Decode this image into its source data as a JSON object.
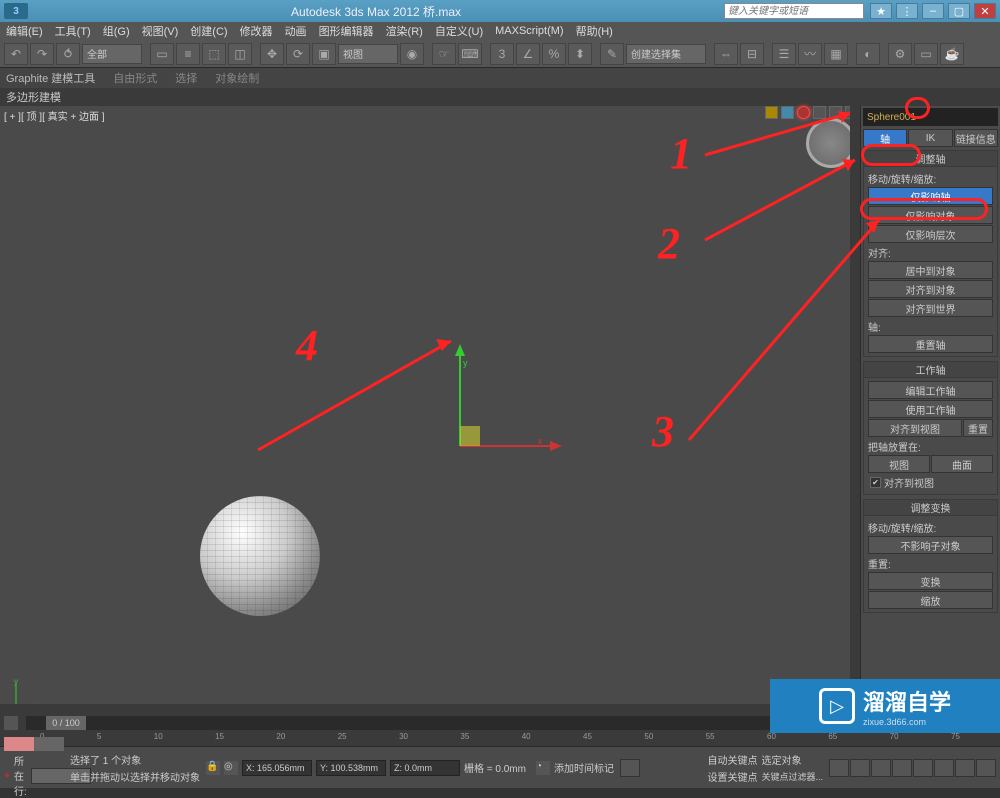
{
  "titlebar": {
    "logo": "3",
    "title": "Autodesk 3ds Max 2012      桥.max",
    "search_placeholder": "键入关键字或短语"
  },
  "menu": [
    "编辑(E)",
    "工具(T)",
    "组(G)",
    "视图(V)",
    "创建(C)",
    "修改器",
    "动画",
    "图形编辑器",
    "渲染(R)",
    "自定义(U)",
    "MAXScript(M)",
    "帮助(H)"
  ],
  "toolbar1": {
    "select_set": "全部",
    "view": "视图",
    "selfilter": "创建选择集"
  },
  "ribbon": {
    "title": "Graphite 建模工具",
    "tabs": [
      "自由形式",
      "选择",
      "对象绘制"
    ],
    "sub": "多边形建模"
  },
  "viewport": {
    "label": "[ + ][ 顶 ][ 真实 + 边面 ]",
    "axis_x": "x",
    "axis_y": "y"
  },
  "object_name": "Sphere001",
  "hier_tabs": {
    "pivot": "轴",
    "ik": "IK",
    "link": "链接信息"
  },
  "sections": {
    "adjust_pivot": {
      "header": "调整轴",
      "label": "移动/旋转/缩放:",
      "btn1": "仅影响轴",
      "btn2": "仅影响对象",
      "btn3": "仅影响层次"
    },
    "align": {
      "label": "对齐:",
      "btn1": "居中到对象",
      "btn2": "对齐到对象",
      "btn3": "对齐到世界"
    },
    "pivot": {
      "label": "轴:",
      "btn1": "重置轴"
    },
    "work": {
      "header": "工作轴",
      "btn1": "编辑工作轴",
      "btn2": "使用工作轴",
      "btn3": "对齐到视图",
      "btn4": "重置",
      "label": "把轴放置在:",
      "btns": [
        "视图",
        "曲面"
      ],
      "check": "对齐到视图"
    },
    "adjust_xform": {
      "header": "调整变换",
      "label": "移动/旋转/缩放:",
      "btn1": "不影响子对象",
      "reset": "重置:",
      "btn2": "变换",
      "btn3": "缩放"
    }
  },
  "timeline": {
    "handle": "0 / 100",
    "ticks": [
      "0",
      "5",
      "10",
      "15",
      "20",
      "25",
      "30",
      "35",
      "40",
      "45",
      "50",
      "55",
      "60",
      "65",
      "70",
      "75"
    ]
  },
  "status": {
    "sel": "选择了 1 个对象",
    "hint": "单击并拖动以选择并移动对象",
    "x": "X: 165.056mm",
    "y": "Y: 100.538mm",
    "z": "Z: 0.0mm",
    "grid": "栅格 = 0.0mm",
    "autokey": "自动关键点",
    "selkey": "选定对象",
    "setkey": "设置关键点",
    "filter": "关键点过滤器...",
    "lock": "所在行:",
    "addtime": "添加时间标记"
  },
  "annotations": {
    "n1": "1",
    "n2": "2",
    "n3": "3",
    "n4": "4"
  },
  "watermark": {
    "main": "溜溜自学",
    "sub": "zixue.3d66.com"
  }
}
